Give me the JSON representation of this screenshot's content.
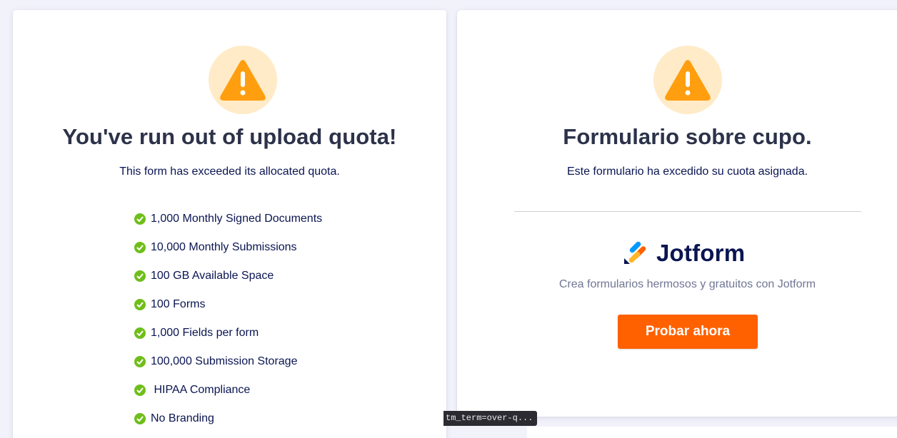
{
  "left_card": {
    "title": "You've run out of upload quota!",
    "subtitle": "This form has exceeded its allocated quota.",
    "features": [
      "1,000 Monthly Signed Documents",
      "10,000 Monthly Submissions",
      "100 GB Available Space",
      "100 Forms",
      "1,000 Fields per form",
      "100,000 Submission Storage",
      " HIPAA Compliance",
      "No Branding"
    ]
  },
  "right_card": {
    "title": "Formulario sobre cupo.",
    "subtitle": "Este formulario ha excedido su cuota asignada.",
    "brand_name": "Jotform",
    "tagline": "Crea formularios hermosos y gratuitos con Jotform",
    "cta_label": "Probar ahora"
  },
  "status_url": "tm_term=over-q...",
  "icons": {
    "warning": "warning-triangle-icon",
    "feature_check": "check-circle-icon",
    "brand_logo": "jotform-logo"
  },
  "colors": {
    "warning_orange": "#ff9e0f",
    "warning_bg": "#ffebc7",
    "check_green": "#6fbe1a",
    "cta_orange": "#ff6100",
    "title_text": "#2c3249",
    "body_text": "#0a1551"
  }
}
